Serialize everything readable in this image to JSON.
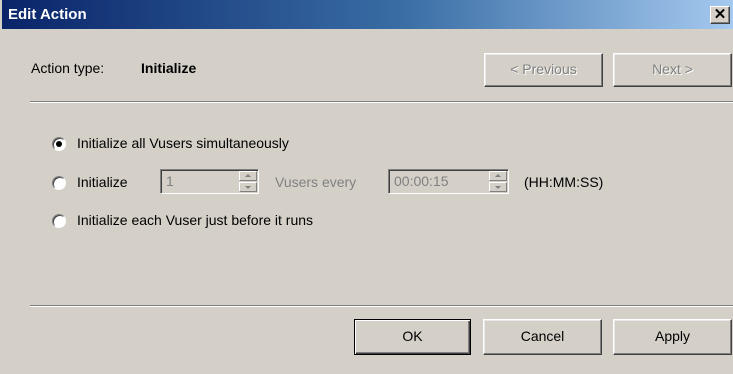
{
  "window": {
    "title": "Edit Action",
    "close_glyph": "✕"
  },
  "header": {
    "action_type_label": "Action type:",
    "action_type_value": "Initialize"
  },
  "nav": {
    "previous_label": "< Previous",
    "next_label": "Next >"
  },
  "options": {
    "all_simultaneously": "Initialize  all Vusers  simultaneously",
    "gradual_prefix": "Initialize",
    "gradual_count": "1",
    "gradual_mid": "Vusers every",
    "gradual_interval": "00:00:15",
    "gradual_unit": "(HH:MM:SS)",
    "each_before_run": "Initialize each Vuser just before it runs",
    "selected": "all_simultaneously"
  },
  "footer": {
    "ok_label": "OK",
    "cancel_label": "Cancel",
    "apply_label": "Apply"
  }
}
